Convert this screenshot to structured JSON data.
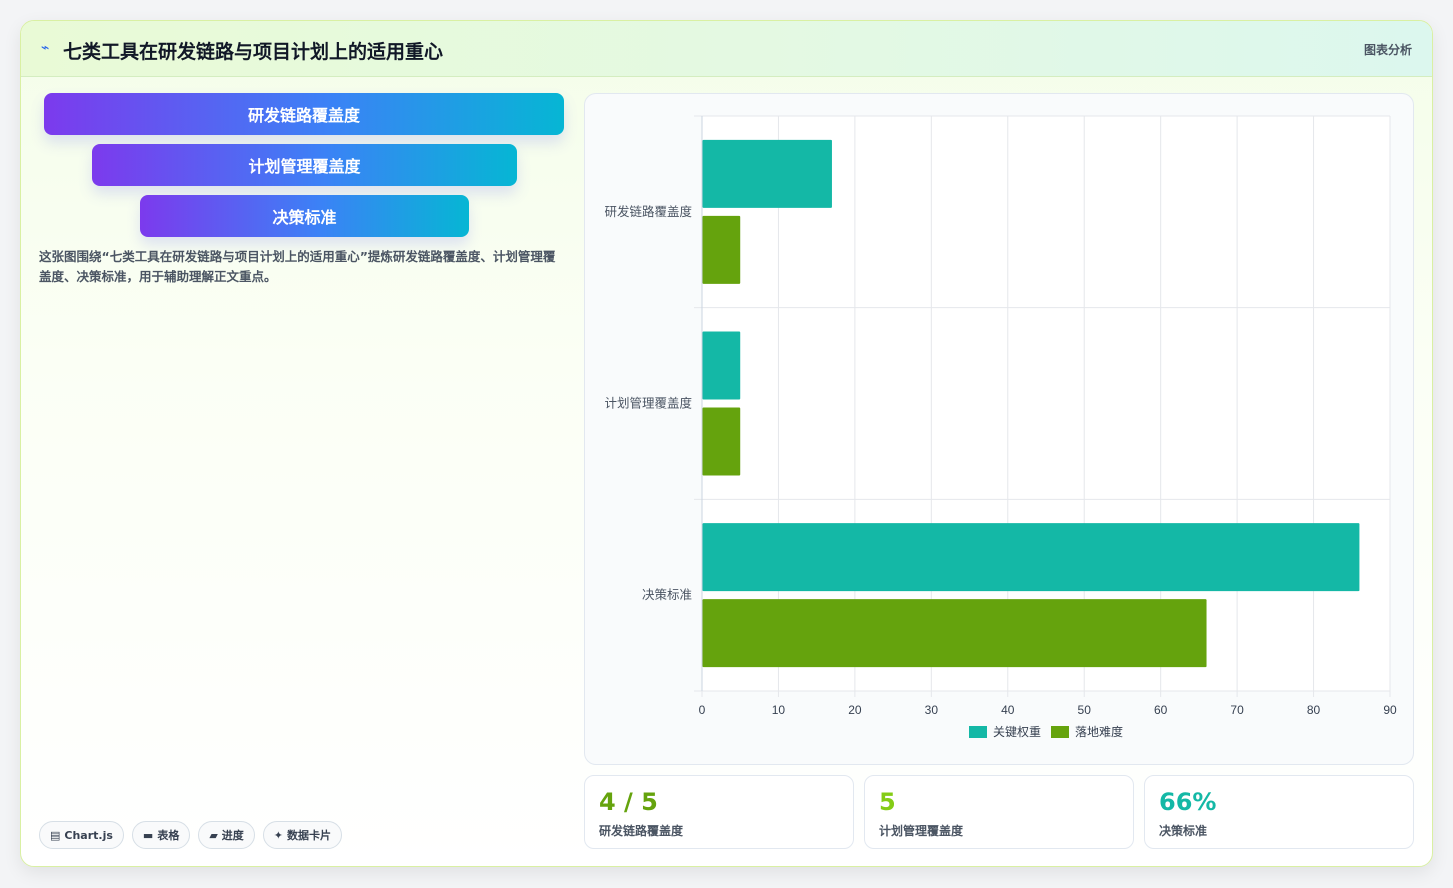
{
  "header": {
    "icon": "chart-line-icon",
    "title": "七类工具在研发链路与项目计划上的适用重心",
    "tag": "图表分析"
  },
  "funnel": {
    "items": [
      {
        "label": "研发链路覆盖度"
      },
      {
        "label": "计划管理覆盖度"
      },
      {
        "label": "决策标准"
      }
    ]
  },
  "description": "这张图围绕“七类工具在研发链路与项目计划上的适用重心”提炼研发链路覆盖度、计划管理覆盖度、决策标准，用于辅助理解正文重点。",
  "chips": [
    {
      "icon": "chart-icon",
      "glyph": "▤",
      "label": "Chart.js"
    },
    {
      "icon": "table-icon",
      "glyph": "▬",
      "label": "表格"
    },
    {
      "icon": "progress-icon",
      "glyph": "▰",
      "label": "进度"
    },
    {
      "icon": "card-icon",
      "glyph": "✦",
      "label": "数据卡片"
    }
  ],
  "colors": {
    "series1": "#14b8a6",
    "series2": "#65a30d",
    "accent_teal": "#14b8a6",
    "accent_green": "#65a30d"
  },
  "chart_data": {
    "type": "bar",
    "orientation": "horizontal",
    "categories": [
      "研发链路覆盖度",
      "计划管理覆盖度",
      "决策标准"
    ],
    "series": [
      {
        "name": "关键权重",
        "values": [
          17,
          5,
          86
        ]
      },
      {
        "name": "落地难度",
        "values": [
          5,
          5,
          66
        ]
      }
    ],
    "xlim": [
      0,
      90
    ],
    "xticks": [
      "0",
      "10",
      "20",
      "30",
      "40",
      "50",
      "60",
      "70",
      "80",
      "90"
    ],
    "grid": true,
    "legend": "bottom"
  },
  "stats": [
    {
      "value": "4 / 5",
      "label": "研发链路覆盖度",
      "color": "#65a30d"
    },
    {
      "value": "5",
      "label": "计划管理覆盖度",
      "color": "#84cc16"
    },
    {
      "value": "66%",
      "label": "决策标准",
      "color": "#14b8a6"
    }
  ]
}
